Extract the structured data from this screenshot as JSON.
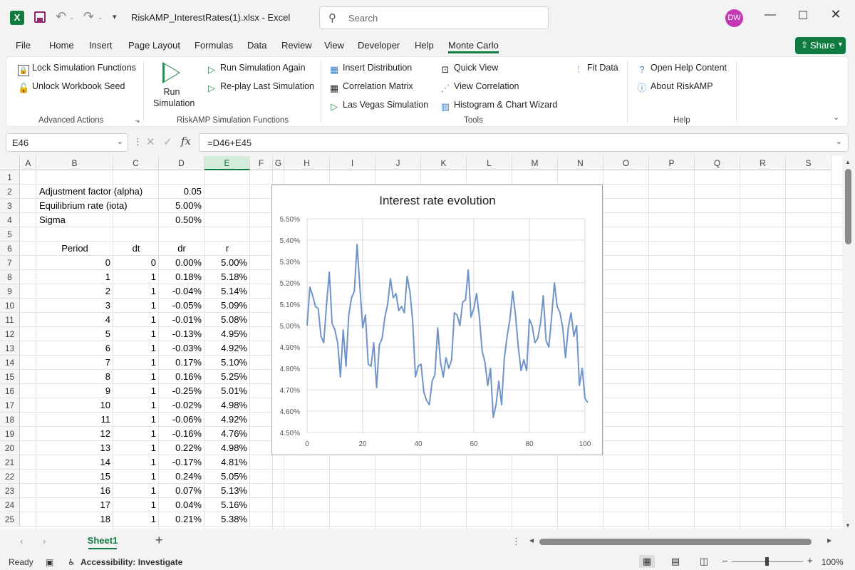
{
  "titlebar": {
    "app_icon": "X",
    "doc_title": "RiskAMP_InterestRates(1).xlsx  -  Excel",
    "search_placeholder": "Search",
    "avatar_initials": "DW",
    "accent": "#107c41"
  },
  "menu": [
    "File",
    "Home",
    "Insert",
    "Page Layout",
    "Formulas",
    "Data",
    "Review",
    "View",
    "Developer",
    "Help",
    "Monte Carlo"
  ],
  "share_label": "Share",
  "ribbon": {
    "advanced": {
      "lock": "Lock Simulation Functions",
      "unlock": "Unlock Workbook Seed",
      "group_label": "Advanced Actions"
    },
    "sim": {
      "run_line1": "Run",
      "run_line2": "Simulation",
      "run_again": "Run Simulation Again",
      "replay": "Re-play Last Simulation",
      "group_label": "RiskAMP Simulation Functions"
    },
    "tools": {
      "insert_dist": "Insert Distribution",
      "corr_matrix": "Correlation Matrix",
      "las_vegas": "Las Vegas Simulation",
      "quick_view": "Quick View",
      "view_corr": "View Correlation",
      "histogram": "Histogram & Chart Wizard",
      "fit_data": "Fit Data",
      "group_label": "Tools"
    },
    "help": {
      "open_help": "Open Help Content",
      "about": "About RiskAMP",
      "group_label": "Help"
    }
  },
  "formula_bar": {
    "name_box": "E46",
    "formula": "=D46+E45",
    "fx": "fx"
  },
  "grid": {
    "columns": [
      "A",
      "B",
      "C",
      "D",
      "E",
      "F",
      "G",
      "H",
      "I",
      "J",
      "K",
      "L",
      "M",
      "N",
      "O",
      "P",
      "Q",
      "R",
      "S"
    ],
    "selected_column": "E",
    "row_numbers": [
      "1",
      "2",
      "3",
      "4",
      "5",
      "6",
      "7",
      "8",
      "9",
      "10",
      "11",
      "12",
      "13",
      "14",
      "15",
      "16",
      "17",
      "18",
      "19",
      "20",
      "21",
      "22",
      "23",
      "24",
      "25"
    ],
    "params": [
      {
        "label": "Adjustment factor (alpha)",
        "value": "0.05"
      },
      {
        "label": "Equilibrium rate (iota)",
        "value": "5.00%"
      },
      {
        "label": "Sigma",
        "value": "0.50%"
      }
    ],
    "table_headers": [
      "Period",
      "dt",
      "dr",
      "r"
    ],
    "table_rows": [
      [
        "0",
        "0",
        "0.00%",
        "5.00%"
      ],
      [
        "1",
        "1",
        "0.18%",
        "5.18%"
      ],
      [
        "2",
        "1",
        "-0.04%",
        "5.14%"
      ],
      [
        "3",
        "1",
        "-0.05%",
        "5.09%"
      ],
      [
        "4",
        "1",
        "-0.01%",
        "5.08%"
      ],
      [
        "5",
        "1",
        "-0.13%",
        "4.95%"
      ],
      [
        "6",
        "1",
        "-0.03%",
        "4.92%"
      ],
      [
        "7",
        "1",
        "0.17%",
        "5.10%"
      ],
      [
        "8",
        "1",
        "0.16%",
        "5.25%"
      ],
      [
        "9",
        "1",
        "-0.25%",
        "5.01%"
      ],
      [
        "10",
        "1",
        "-0.02%",
        "4.98%"
      ],
      [
        "11",
        "1",
        "-0.06%",
        "4.92%"
      ],
      [
        "12",
        "1",
        "-0.16%",
        "4.76%"
      ],
      [
        "13",
        "1",
        "0.22%",
        "4.98%"
      ],
      [
        "14",
        "1",
        "-0.17%",
        "4.81%"
      ],
      [
        "15",
        "1",
        "0.24%",
        "5.05%"
      ],
      [
        "16",
        "1",
        "0.07%",
        "5.13%"
      ],
      [
        "17",
        "1",
        "0.04%",
        "5.16%"
      ],
      [
        "18",
        "1",
        "0.21%",
        "5.38%"
      ]
    ]
  },
  "chart_data": {
    "type": "line",
    "title": "Interest rate evolution",
    "xlabel": "",
    "ylabel": "",
    "xlim": [
      0,
      100
    ],
    "ylim": [
      4.5,
      5.5
    ],
    "x_ticks": [
      "0",
      "20",
      "40",
      "60",
      "80",
      "100"
    ],
    "y_ticks": [
      "4.50%",
      "4.60%",
      "4.70%",
      "4.80%",
      "4.90%",
      "5.00%",
      "5.10%",
      "5.20%",
      "5.30%",
      "5.40%",
      "5.50%"
    ],
    "grid": true,
    "legend": "none",
    "line_color": "#6f94c8",
    "series": [
      {
        "values": [
          5.0,
          5.18,
          5.14,
          5.09,
          5.08,
          4.95,
          4.92,
          5.1,
          5.25,
          5.01,
          4.98,
          4.92,
          4.76,
          4.98,
          4.81,
          5.05,
          5.13,
          5.16,
          5.38,
          5.18,
          4.99,
          5.05,
          4.82,
          4.81,
          4.92,
          4.71,
          4.91,
          4.94,
          5.04,
          5.1,
          5.22,
          5.13,
          5.15,
          5.07,
          5.09,
          5.06,
          5.23,
          5.16,
          5.02,
          4.76,
          4.81,
          4.82,
          4.69,
          4.65,
          4.63,
          4.74,
          4.77,
          4.99,
          4.83,
          4.76,
          4.85,
          4.8,
          4.84,
          5.06,
          5.05,
          5.0,
          5.11,
          5.12,
          5.26,
          5.04,
          5.08,
          5.15,
          5.04,
          4.88,
          4.83,
          4.72,
          4.8,
          4.57,
          4.63,
          4.74,
          4.63,
          4.85,
          4.95,
          5.03,
          5.16,
          5.05,
          4.9,
          4.79,
          4.84,
          4.79,
          5.03,
          5.0,
          4.92,
          4.94,
          5.01,
          5.14,
          4.93,
          4.9,
          5.04,
          5.2,
          5.09,
          5.06,
          4.99,
          4.85,
          4.99,
          5.06,
          4.95,
          5.0,
          4.72,
          4.8,
          4.66,
          4.64
        ]
      }
    ]
  },
  "sheet_tabs": {
    "active": "Sheet1",
    "add": "+"
  },
  "status": {
    "ready": "Ready",
    "accessibility": "Accessibility: Investigate",
    "zoom": "100%"
  }
}
